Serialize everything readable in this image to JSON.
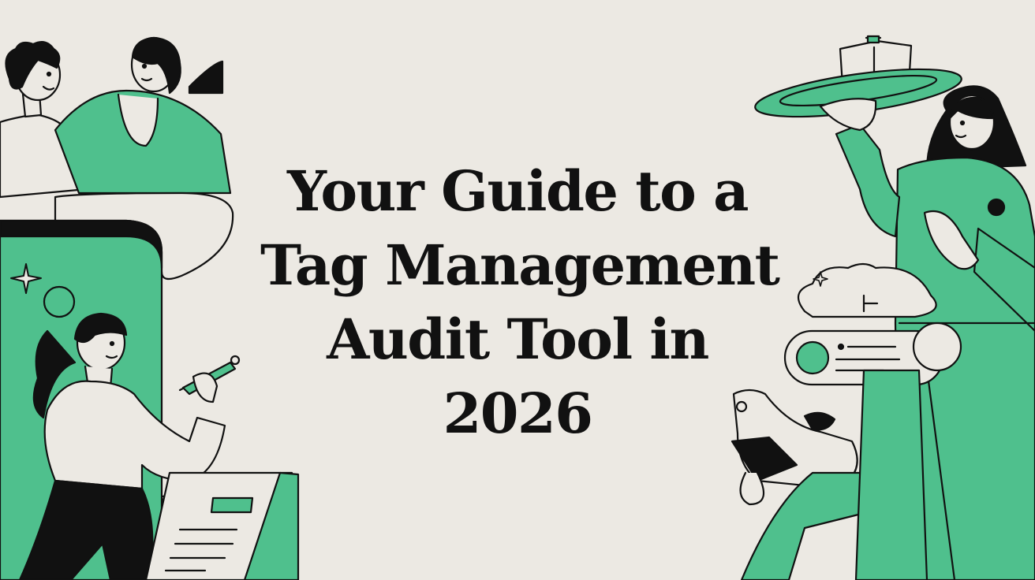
{
  "hero": {
    "title_lines": [
      "Your Guide to a",
      "Tag Management",
      "Audit Tool in",
      "2026"
    ]
  },
  "colors": {
    "background": "#ece9e3",
    "accent_green": "#4fc08d",
    "ink": "#111111",
    "paper": "#ece9e3"
  },
  "illustration": {
    "left_icons": [
      "person-curly-hair",
      "person-green-shirt",
      "phone-screen",
      "sparkle-icon",
      "woman-writing-with-pen",
      "document-board"
    ],
    "right_icons": [
      "flying-disc-with-box",
      "woman-green-outfit",
      "cloud-chat-bubble",
      "toggle-card",
      "dog-figure",
      "sparkle-icon"
    ]
  }
}
